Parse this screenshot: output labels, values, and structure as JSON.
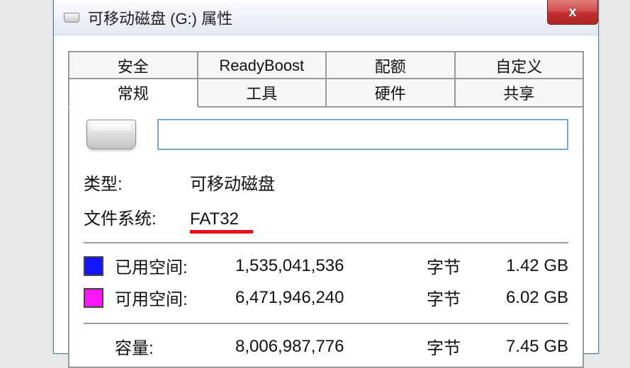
{
  "window": {
    "title": "可移动磁盘 (G:) 属性",
    "close_glyph": "x"
  },
  "tabs": {
    "row1": [
      "安全",
      "ReadyBoost",
      "配额",
      "自定义"
    ],
    "row2": [
      "常规",
      "工具",
      "硬件",
      "共享"
    ],
    "active": "常规"
  },
  "general": {
    "name_value": "",
    "type_label": "类型:",
    "type_value": "可移动磁盘",
    "fs_label": "文件系统:",
    "fs_value": "FAT32",
    "used": {
      "label": "已用空间:",
      "bytes": "1,535,041,536",
      "unit": "字节",
      "gb": "1.42 GB",
      "color": "#1414ff"
    },
    "free": {
      "label": "可用空间:",
      "bytes": "6,471,946,240",
      "unit": "字节",
      "gb": "6.02 GB",
      "color": "#ff17ff"
    },
    "capacity": {
      "label": "容量:",
      "bytes": "8,006,987,776",
      "unit": "字节",
      "gb": "7.45 GB"
    }
  }
}
